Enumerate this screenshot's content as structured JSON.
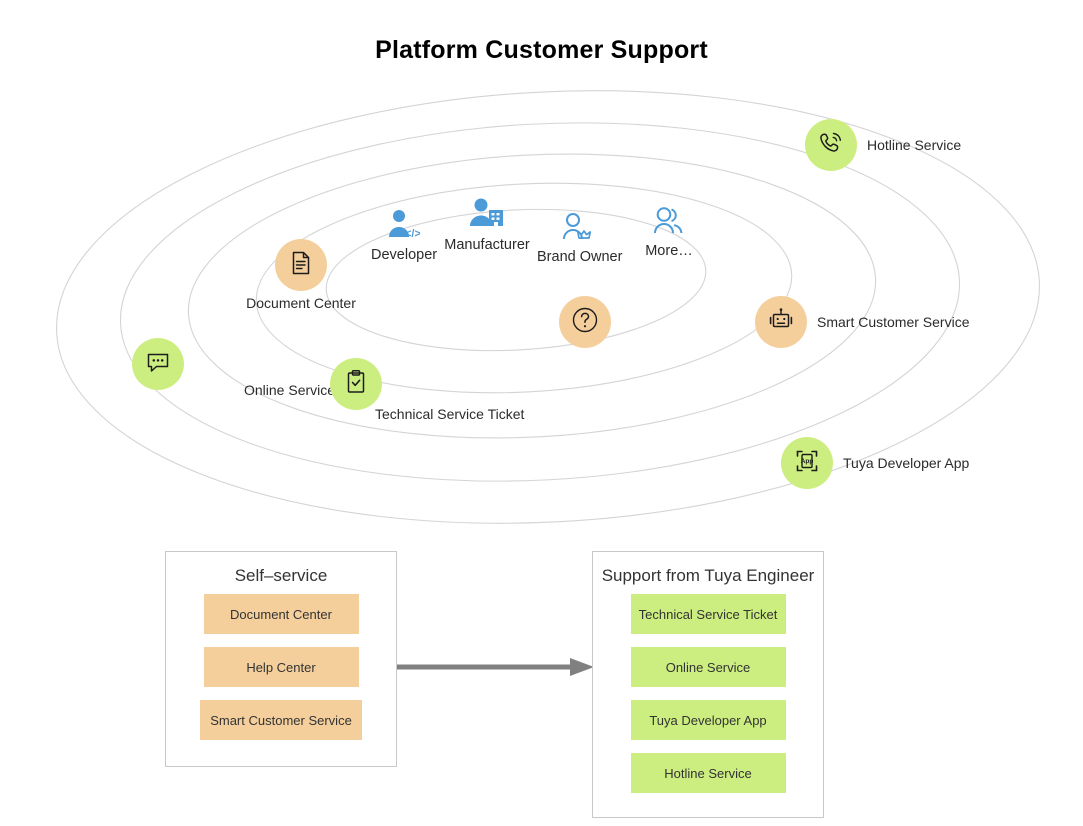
{
  "page": {
    "title": "Platform Customer Support",
    "background": "#ffffff"
  },
  "colors": {
    "green": "#ccee80",
    "peach": "#f4cf9c",
    "role_blue": "#4a9bd8",
    "orbit_stroke": "#d4d4d4",
    "arrow": "#808080",
    "panel_border": "#c9c9c9",
    "text": "#2b2b2b"
  },
  "roles": [
    {
      "label": "Developer",
      "icon": "developer-icon"
    },
    {
      "label": "Manufacturer",
      "icon": "manufacturer-icon"
    },
    {
      "label": "Brand Owner",
      "icon": "brand-owner-icon"
    },
    {
      "label": "More…",
      "icon": "more-users-icon"
    }
  ],
  "services": [
    {
      "label": "Hotline Service",
      "icon": "phone-icon",
      "color": "green"
    },
    {
      "label": "Document Center",
      "icon": "document-icon",
      "color": "peach"
    },
    {
      "label": "Smart Customer Service",
      "icon": "robot-icon",
      "color": "peach"
    },
    {
      "label": "Online Service",
      "icon": "chat-icon",
      "color": "green"
    },
    {
      "label": "Technical Service Ticket",
      "icon": "clipboard-icon",
      "color": "green"
    },
    {
      "label": "Tuya Developer App",
      "icon": "app-icon",
      "color": "green"
    },
    {
      "label": "",
      "icon": "question-icon",
      "color": "peach"
    }
  ],
  "panels": {
    "self_service": {
      "title": "Self–service",
      "items": [
        {
          "label": "Document Center"
        },
        {
          "label": "Help Center"
        },
        {
          "label": "Smart Customer Service"
        }
      ]
    },
    "engineer_support": {
      "title": "Support from Tuya Engineer",
      "items": [
        {
          "label": "Technical Service Ticket"
        },
        {
          "label": "Online Service"
        },
        {
          "label": "Tuya Developer App"
        },
        {
          "label": "Hotline Service"
        }
      ]
    }
  },
  "arrow": {
    "direction": "right"
  }
}
